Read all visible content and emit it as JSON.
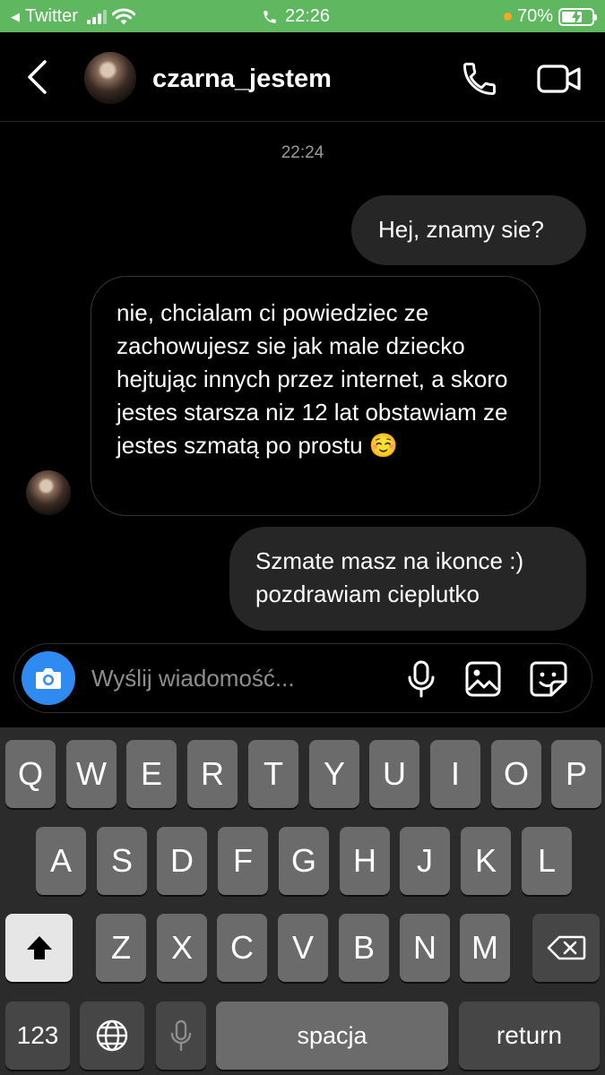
{
  "status_bar": {
    "back_app": "Twitter",
    "time": "22:26",
    "battery": "70%",
    "battery_level": 0.7,
    "icons": [
      "back-arrow-icon",
      "signal-bars-icon",
      "wifi-icon",
      "phone-call-icon",
      "orange-dot-icon",
      "battery-charging-icon"
    ]
  },
  "header": {
    "username": "czarna_jestem",
    "icons": [
      "chevron-left-icon",
      "avatar",
      "phone-icon",
      "video-camera-icon"
    ]
  },
  "conversation": {
    "timestamp": "22:24",
    "messages": [
      {
        "direction": "sent",
        "text": "Hej, znamy sie?"
      },
      {
        "direction": "received",
        "text": "nie, chcialam ci powiedziec ze zachowujesz sie jak male dziecko hejtując innych przez internet, a skoro jestes starsza niz 12 lat obstawiam ze jestes szmatą po prostu ☺️"
      },
      {
        "direction": "sent",
        "text": "Szmate masz na ikonce :) pozdrawiam cieplutko"
      }
    ]
  },
  "composer": {
    "placeholder": "Wyślij wiadomość...",
    "icons": [
      "camera-icon",
      "microphone-icon",
      "gallery-icon",
      "sticker-icon"
    ]
  },
  "keyboard": {
    "row1": [
      "Q",
      "W",
      "E",
      "R",
      "T",
      "Y",
      "U",
      "I",
      "O",
      "P"
    ],
    "row2": [
      "A",
      "S",
      "D",
      "F",
      "G",
      "H",
      "J",
      "K",
      "L"
    ],
    "row3": [
      "Z",
      "X",
      "C",
      "V",
      "B",
      "N",
      "M"
    ],
    "numbers_label": "123",
    "space_label": "spacja",
    "return_label": "return",
    "icons": [
      "shift-icon",
      "backspace-icon",
      "globe-icon",
      "dictation-mic-icon"
    ]
  },
  "colors": {
    "status_bar_bg": "#5fb85f",
    "background": "#000000",
    "sent_bubble": "#262626",
    "camera_button": "#2f8bf0",
    "keyboard_bg": "#2b2b2b",
    "key_bg": "#6b6b6b",
    "function_key_bg": "#464646"
  }
}
